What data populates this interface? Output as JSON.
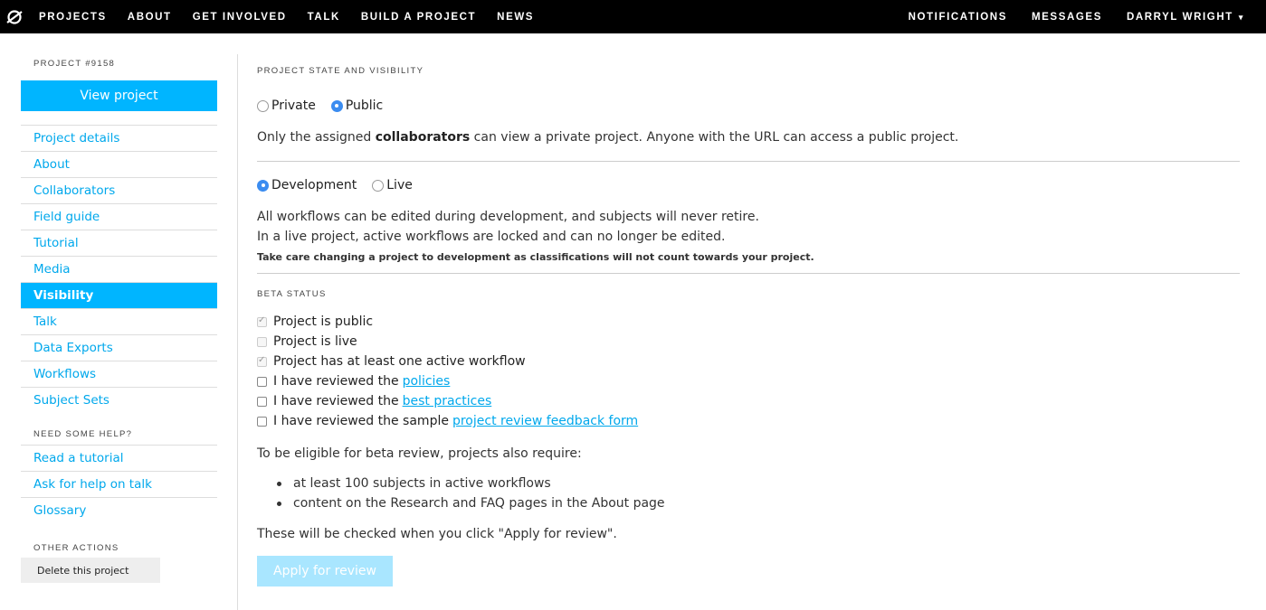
{
  "topnav": {
    "logo_icon": "zooniverse-logo-icon",
    "left_links": [
      "Projects",
      "About",
      "Get Involved",
      "Talk",
      "Build a Project",
      "News"
    ],
    "right_links": [
      "Notifications",
      "Messages"
    ],
    "user_name": "Darryl Wright",
    "user_caret": "▾"
  },
  "sidebar": {
    "project_id": "Project #9158",
    "view_project_label": "View project",
    "items": [
      "Project details",
      "About",
      "Collaborators",
      "Field guide",
      "Tutorial",
      "Media",
      "Visibility",
      "Talk",
      "Data Exports",
      "Workflows",
      "Subject Sets"
    ],
    "active_item": "Visibility",
    "help_heading": "Need some help?",
    "help_items": [
      "Read a tutorial",
      "Ask for help on talk",
      "Glossary"
    ],
    "other_heading": "Other actions",
    "delete_label": "Delete this project"
  },
  "main": {
    "state_heading": "Project state and visibility",
    "visibility": {
      "private_label": "Private",
      "public_label": "Public",
      "selected": "Public",
      "desc_before": "Only the assigned ",
      "desc_bold": "collaborators",
      "desc_after": " can view a private project. Anyone with the URL can access a public project."
    },
    "status": {
      "development_label": "Development",
      "live_label": "Live",
      "selected": "Development",
      "desc_line1": "All workflows can be edited during development, and subjects will never retire.",
      "desc_line2": "In a live project, active workflows are locked and can no longer be edited.",
      "warning": "Take care changing a project to development as classifications will not count towards your project."
    },
    "beta_heading": "Beta status",
    "beta_checks": [
      {
        "label": "Project is public",
        "checked": true,
        "disabled": true
      },
      {
        "label": "Project is live",
        "checked": false,
        "disabled": true
      },
      {
        "label": "Project has at least one active workflow",
        "checked": true,
        "disabled": true
      },
      {
        "label": "I have reviewed the",
        "link": "policies",
        "checked": false,
        "disabled": false
      },
      {
        "label": "I have reviewed the",
        "link": "best practices",
        "checked": false,
        "disabled": false
      },
      {
        "label": "I have reviewed the sample",
        "link": "project review feedback form",
        "checked": false,
        "disabled": false
      }
    ],
    "requirements_intro": "To be eligible for beta review, projects also require:",
    "requirements": [
      "at least 100 subjects in active workflows",
      "content on the Research and FAQ pages in the About page"
    ],
    "checked_note": "These will be checked when you click \"Apply for review\".",
    "apply_label": "Apply for review"
  },
  "colors": {
    "accent": "#00b5ff",
    "link": "#00a8ec",
    "nav_bg": "#000000",
    "apply_disabled": "#a9e6ff"
  }
}
